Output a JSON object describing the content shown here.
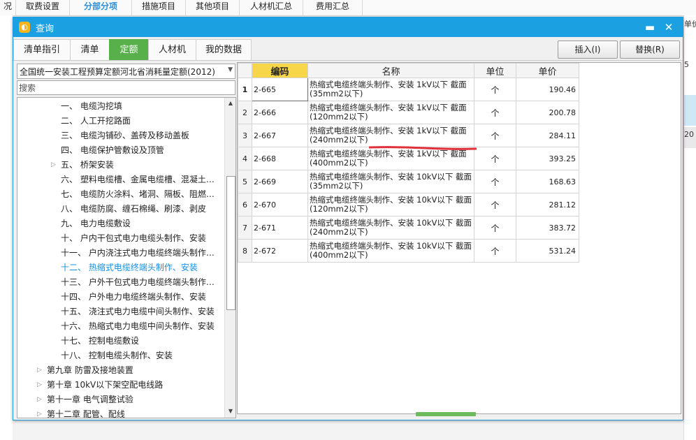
{
  "app_tabs": [
    "况",
    "取费设置",
    "分部分项",
    "措施项目",
    "其他项目",
    "人材机汇总",
    "费用汇总"
  ],
  "app_active_tab": "分部分项",
  "background_right": {
    "header": "单价",
    "top": "单价",
    "value1": "5",
    "value2": "20"
  },
  "dialog": {
    "title": "查询",
    "minimize_glyph": "▬",
    "close_glyph": "✕",
    "tabs": [
      "清单指引",
      "清单",
      "定额",
      "人材机",
      "我的数据"
    ],
    "active_tab": "定额",
    "insert_label": "插入(I)",
    "replace_label": "替换(R)"
  },
  "left_panel": {
    "quota_book": "全国统一安装工程预算定额河北省消耗量定额(2012)",
    "search_placeholder": "搜索",
    "tree": [
      {
        "label": "一、 电缆沟挖填",
        "level": 2
      },
      {
        "label": "二、 人工开挖路面",
        "level": 2
      },
      {
        "label": "三、 电缆沟铺砂、盖砖及移动盖板",
        "level": 2
      },
      {
        "label": "四、 电缆保护管敷设及顶管",
        "level": 2
      },
      {
        "label": "五、 桥架安装",
        "level": 2,
        "expandable": true
      },
      {
        "label": "六、 塑料电缆槽、金属电缆槽、混凝土…",
        "level": 2
      },
      {
        "label": "七、 电缆防火涂料、堵洞、隔板、阻燃…",
        "level": 2
      },
      {
        "label": "八、 电缆防腐、缠石棉绳、刷漆、剥皮",
        "level": 2
      },
      {
        "label": "九、 电力电缆敷设",
        "level": 2
      },
      {
        "label": "十、 户内干包式电力电缆头制作、安装",
        "level": 2
      },
      {
        "label": "十一、 户内浇注式电力电缆终端头制作…",
        "level": 2
      },
      {
        "label": "十二、 热缩式电缆终端头制作、安装",
        "level": 2,
        "selected": true
      },
      {
        "label": "十三、 户外干包式电力电缆终端头制作…",
        "level": 2
      },
      {
        "label": "十四、 户外电力电缆终端头制作、安装",
        "level": 2
      },
      {
        "label": "十五、 浇注式电力电缆中间头制作、安装",
        "level": 2
      },
      {
        "label": "十六、 热缩式电力电缆中间头制作、安装",
        "level": 2
      },
      {
        "label": "十七、 控制电缆敷设",
        "level": 2
      },
      {
        "label": "十八、 控制电缆头制作、安装",
        "level": 2
      },
      {
        "label": "第九章 防雷及接地装置",
        "level": 1,
        "expandable": true
      },
      {
        "label": "第十章 10kV以下架空配电线路",
        "level": 1,
        "expandable": true
      },
      {
        "label": "第十一章 电气调整试验",
        "level": 1,
        "expandable": true
      },
      {
        "label": "第十二章 配管、配线",
        "level": 1,
        "expandable": true
      }
    ]
  },
  "results": {
    "columns": [
      "",
      "编码",
      "名称",
      "单位",
      "单价"
    ],
    "rows": [
      {
        "no": "1",
        "code": "2-665",
        "name": "热缩式电缆终端头制作、安装 1kV以下 截面(35mm2以下)",
        "unit": "个",
        "price": "190.46"
      },
      {
        "no": "2",
        "code": "2-666",
        "name": "热缩式电缆终端头制作、安装 1kV以下 截面(120mm2以下)",
        "unit": "个",
        "price": "200.78"
      },
      {
        "no": "3",
        "code": "2-667",
        "name": "热缩式电缆终端头制作、安装 1kV以下 截面(240mm2以下)",
        "unit": "个",
        "price": "284.11"
      },
      {
        "no": "4",
        "code": "2-668",
        "name": "热缩式电缆终端头制作、安装 1kV以下 截面(400mm2以下)",
        "unit": "个",
        "price": "393.25"
      },
      {
        "no": "5",
        "code": "2-669",
        "name": "热缩式电缆终端头制作、安装 10kV以下 截面(35mm2以下)",
        "unit": "个",
        "price": "168.63"
      },
      {
        "no": "6",
        "code": "2-670",
        "name": "热缩式电缆终端头制作、安装 10kV以下 截面(120mm2以下)",
        "unit": "个",
        "price": "281.12"
      },
      {
        "no": "7",
        "code": "2-671",
        "name": "热缩式电缆终端头制作、安装 10kV以下 截面(240mm2以下)",
        "unit": "个",
        "price": "383.72"
      },
      {
        "no": "8",
        "code": "2-672",
        "name": "热缩式电缆终端头制作、安装 10kV以下 截面(400mm2以下)",
        "unit": "个",
        "price": "531.24"
      }
    ]
  },
  "colors": {
    "accent_blue": "#1ba1e2",
    "active_green": "#58b04a",
    "header_yellow": "#f7d64a",
    "annotation_red": "#e0303a"
  }
}
